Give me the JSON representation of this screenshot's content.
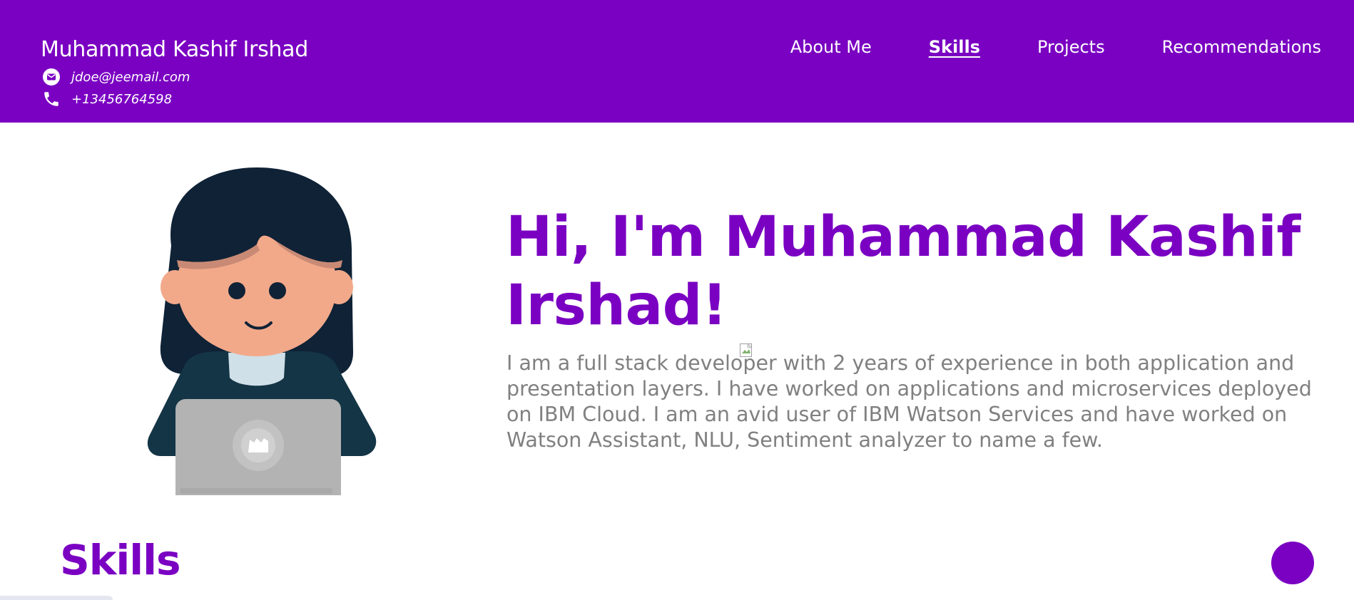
{
  "header": {
    "name": "Muhammad Kashif Irshad",
    "email": "jdoe@jeemail.com",
    "phone": "+13456764598",
    "icons": {
      "email": "envelope-icon",
      "phone": "phone-icon"
    },
    "nav": [
      {
        "label": "About Me",
        "active": false
      },
      {
        "label": "Skills",
        "active": true
      },
      {
        "label": "Projects",
        "active": false
      },
      {
        "label": "Recommendations",
        "active": false
      }
    ]
  },
  "hero": {
    "title": "Hi, I'm Muhammad Kashif Irshad!",
    "description": "I am a full stack developer with 2 years of experience in both application and presentation layers. I have worked on applications and microservices deployed on IBM Cloud. I am an avid user of IBM Watson Services and have worked on Watson Assistant, NLU, Sentiment analyzer to name a few."
  },
  "skills": {
    "heading": "Skills"
  },
  "colors": {
    "brand": "#7a00c2",
    "text_muted": "#808080",
    "background": "#ffffff"
  }
}
